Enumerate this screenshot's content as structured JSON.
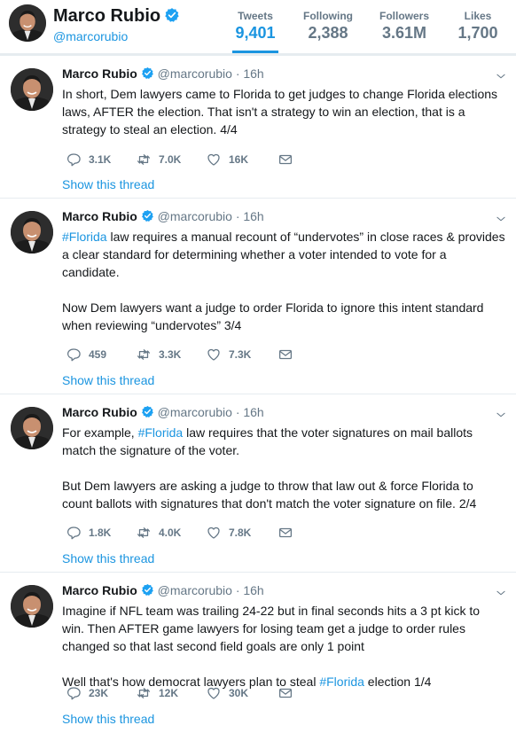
{
  "profile": {
    "name": "Marco Rubio",
    "handle": "@marcorubio"
  },
  "stats": [
    {
      "label": "Tweets",
      "value": "9,401"
    },
    {
      "label": "Following",
      "value": "2,388"
    },
    {
      "label": "Followers",
      "value": "3.61M"
    },
    {
      "label": "Likes",
      "value": "1,700"
    }
  ],
  "tweets": [
    {
      "name": "Marco Rubio",
      "handle": "@marcorubio",
      "time": "· 16h",
      "lines": [
        "In short, Dem lawyers came to Florida to get judges to change Florida elections",
        "laws, AFTER the election. That isn't a strategy to win an election, that is a",
        "strategy to steal an election. 4/4"
      ],
      "replies": "3.1K",
      "retweets": "7.0K",
      "likes": "16K",
      "show_thread": "Show this thread"
    },
    {
      "name": "Marco Rubio",
      "handle": "@marcorubio",
      "time": "· 16h",
      "line1_hashtag": "#Florida",
      "line1_rest": " law requires a manual recount of “undervotes” in close races & provides",
      "lines": [
        "a clear standard for determining whether a voter intended to vote for a",
        "candidate.",
        "",
        "Now Dem lawyers want a judge to order Florida to ignore this intent standard",
        "when reviewing “undervotes” 3/4"
      ],
      "replies": "459",
      "retweets": "3.3K",
      "likes": "7.3K",
      "show_thread": "Show this thread"
    },
    {
      "name": "Marco Rubio",
      "handle": "@marcorubio",
      "time": "· 16h",
      "line1_pre": "For example, ",
      "line1_hashtag": "#Florida",
      "line1_rest": " law requires that the voter signatures on mail ballots",
      "lines": [
        "match the signature of the voter.",
        "",
        "But Dem lawyers are asking a judge to throw that law out & force Florida to",
        "count ballots with signatures that don't match the voter signature on file. 2/4"
      ],
      "replies": "1.8K",
      "retweets": "4.0K",
      "likes": "7.8K",
      "show_thread": "Show this thread"
    },
    {
      "name": "Marco Rubio",
      "handle": "@marcorubio",
      "time": "· 16h",
      "lines": [
        "Imagine if NFL team was trailing 24-22 but in final seconds hits a 3 pt kick to",
        "win. Then AFTER game lawyers for losing team get a judge to order rules",
        "changed so that last second field goals are only 1 point",
        ""
      ],
      "last_pre": "Well that's how democrat lawyers plan to steal ",
      "last_hashtag": "#Florida",
      "last_rest": " election 1/4",
      "replies": "23K",
      "retweets": "12K",
      "likes": "30K",
      "show_thread": "Show this thread"
    }
  ],
  "colors": {
    "accent": "#1b95e0",
    "muted": "#657786",
    "background": "#e6ecf0"
  }
}
